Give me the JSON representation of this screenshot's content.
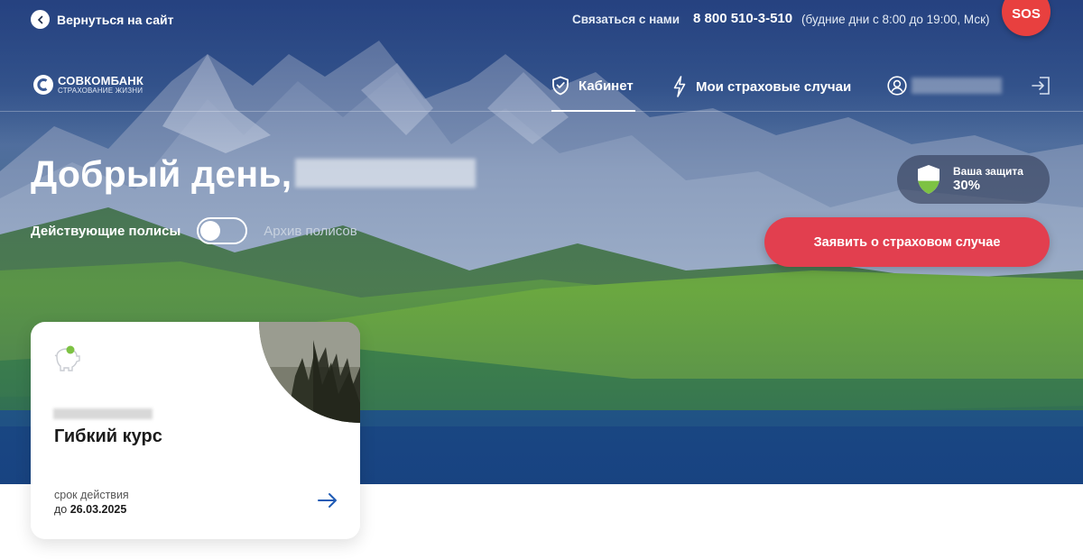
{
  "topbar": {
    "back_label": "Вернуться на сайт",
    "contact_label": "Связаться с нами",
    "phone": "8 800 510-3-510",
    "hours": "(будние дни с 8:00 до 19:00, Мск)",
    "sos_label": "SOS"
  },
  "logo": {
    "name": "СОВКОМБАНК",
    "subtitle": "СТРАХОВАНИЕ ЖИЗНИ"
  },
  "nav": {
    "cabinet_label": "Кабинет",
    "cases_label": "Мои страховые случаи",
    "active_tab": "Кабинет"
  },
  "main": {
    "greeting": "Добрый день,",
    "toggle_left": "Действующие полисы",
    "toggle_right": "Архив полисов",
    "protection_title": "Ваша защита",
    "protection_value": "30%",
    "protection_level": 0.3,
    "claim_button": "Заявить о страховом случае"
  },
  "policy_card": {
    "title": "Гибкий курс",
    "term_label": "срок действия",
    "term_prefix": "до",
    "term_date": "26.03.2025"
  },
  "colors": {
    "accent_red": "#e23f4f",
    "sos_red": "#e8403f",
    "shield_green": "#7dc243",
    "card_arrow": "#1f5bb5"
  },
  "icons": [
    "chevron-left-icon",
    "shield-check-icon",
    "lightning-icon",
    "user-icon",
    "logout-icon",
    "shield-icon",
    "piggy-bank-icon",
    "arrow-right-icon"
  ]
}
